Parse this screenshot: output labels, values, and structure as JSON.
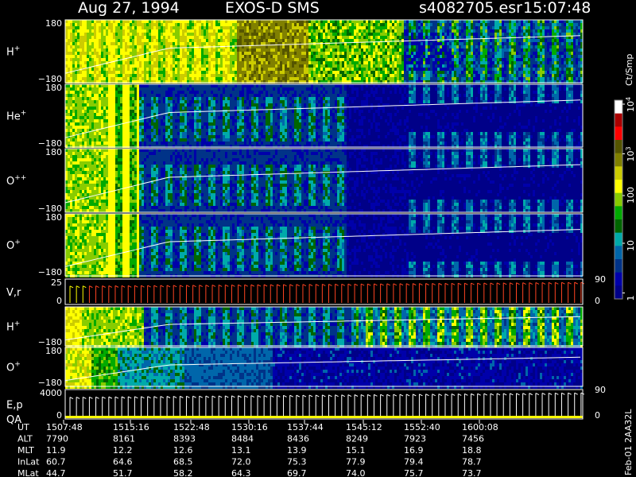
{
  "header": {
    "date": "Aug 27, 1994",
    "instrument": "EXOS-D SMS",
    "file": "s4082705.esr",
    "time": "15:07:48"
  },
  "chart_data": {
    "type": "heatmap",
    "panels": [
      {
        "label_base": "H",
        "label_sup": "+",
        "ytick_top": "180",
        "ytick_bottom": "−180",
        "kind": "spec",
        "profile": "h1"
      },
      {
        "label_base": "He",
        "label_sup": "+",
        "ytick_top": "180",
        "ytick_bottom": "−180",
        "kind": "spec",
        "profile": "he"
      },
      {
        "label_base": "O",
        "label_sup": "++",
        "ytick_top": "180",
        "ytick_bottom": "−180",
        "kind": "spec",
        "profile": "opp"
      },
      {
        "label_base": "O",
        "label_sup": "+",
        "ytick_top": "180",
        "ytick_bottom": "−180",
        "kind": "spec",
        "profile": "op"
      },
      {
        "label_base": "V,r",
        "label_sup": "",
        "ytick_top": "25",
        "ytick_bottom": "0",
        "right_top": "90",
        "right_bottom": "0",
        "kind": "line"
      },
      {
        "label_base": "H",
        "label_sup": "+",
        "ytick_top": "",
        "ytick_bottom": "−180",
        "kind": "spec",
        "profile": "h2"
      },
      {
        "label_base": "O",
        "label_sup": "+",
        "ytick_top": "180",
        "ytick_bottom": "−180",
        "kind": "spec",
        "profile": "op2"
      },
      {
        "label_base": "E,p",
        "label_sup": "",
        "label2": "QA",
        "ytick_top": "4000",
        "ytick_bottom": "0",
        "right_top": "90",
        "right_bottom": "0",
        "kind": "line2"
      }
    ],
    "colorbar": {
      "title": "Ct/Smp",
      "labels": [
        {
          "base": "10",
          "sup": "4",
          "frac": 0.02
        },
        {
          "base": "10",
          "sup": "3",
          "frac": 0.27
        },
        {
          "base": "100",
          "sup": "",
          "frac": 0.48
        },
        {
          "base": "10",
          "sup": "",
          "frac": 0.72
        },
        {
          "base": "1",
          "sup": "",
          "frac": 0.97
        }
      ],
      "colors": [
        "#ffffff",
        "#aa0000",
        "#ff0000",
        "#555500",
        "#808000",
        "#cccc00",
        "#ffff00",
        "#88cc00",
        "#00aa00",
        "#006600",
        "#00aaaa",
        "#0066aa",
        "#003388",
        "#0000aa",
        "#000088"
      ]
    },
    "color_scale": [
      "#000088",
      "#0000aa",
      "#003388",
      "#0066aa",
      "#00aaaa",
      "#006600",
      "#00aa00",
      "#88cc00",
      "#ffff00",
      "#cccc00",
      "#808000",
      "#555500",
      "#ff0000"
    ],
    "footer_rows": [
      {
        "label": "UT",
        "values": [
          "1507:48",
          "1515:16",
          "1522:48",
          "1530:16",
          "1537:44",
          "1545:12",
          "1552:40",
          "1600:08"
        ]
      },
      {
        "label": "ALT",
        "values": [
          "7790",
          "8161",
          "8393",
          "8484",
          "8436",
          "8249",
          "7923",
          "7456"
        ]
      },
      {
        "label": "MLT",
        "values": [
          "11.9",
          "12.2",
          "12.6",
          "13.1",
          "13.9",
          "15.1",
          "16.9",
          "18.8"
        ]
      },
      {
        "label": "InLat",
        "values": [
          "60.7",
          "64.6",
          "68.5",
          "72.0",
          "75.3",
          "77.9",
          "79.4",
          "78.7"
        ]
      },
      {
        "label": "MLat",
        "values": [
          "44.7",
          "51.7",
          "58.2",
          "64.3",
          "69.7",
          "74.0",
          "75.7",
          "73.7"
        ]
      }
    ],
    "side_label": "Feb-01  2AA32L"
  }
}
